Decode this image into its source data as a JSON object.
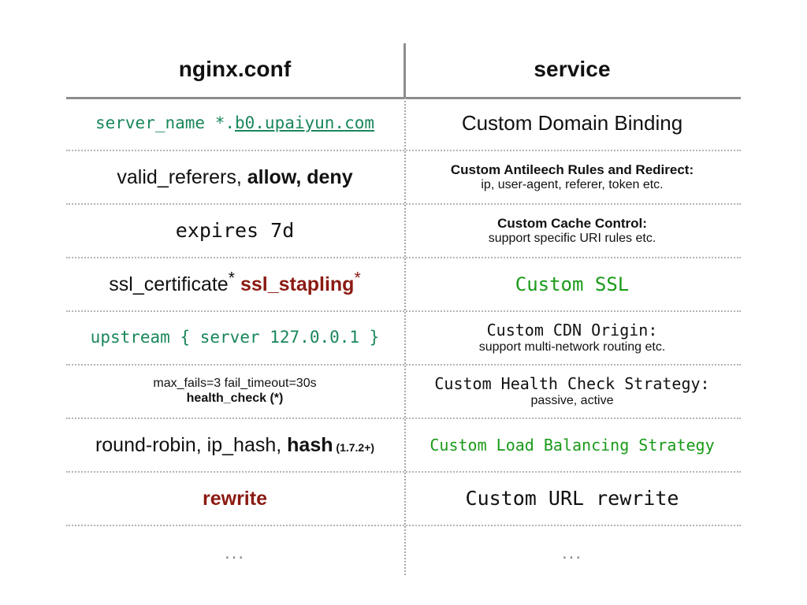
{
  "table": {
    "headers": {
      "left": "nginx.conf",
      "right": "service"
    },
    "rows": [
      {
        "left": {
          "main_prefix": "server_name *.",
          "main_link": "b0.upaiyun.com",
          "style": "mono-green-link"
        },
        "right": {
          "main": "Custom Domain Binding",
          "sub": "",
          "style": "sans-plain-large"
        }
      },
      {
        "left": {
          "main_plain": "valid_referers, ",
          "main_bold": "allow, deny",
          "style": "sans-mixed"
        },
        "right": {
          "main": "Custom Antileech Rules and Redirect:",
          "sub": "ip, user-agent, referer, token etc.",
          "style": "sans-bold-title-sub"
        }
      },
      {
        "left": {
          "main": "expires 7d",
          "style": "mono-black"
        },
        "right": {
          "main": "Custom Cache Control:",
          "sub": "support specific URI rules etc.",
          "style": "sans-bold-title-sub"
        }
      },
      {
        "left": {
          "main_plain": "ssl_certificate",
          "main_star1": "*",
          "main_bold": "ssl_stapling",
          "main_star2": "*",
          "style": "sans-mixed-red"
        },
        "right": {
          "main": "Custom SSL",
          "sub": "",
          "style": "mono-green-bright"
        }
      },
      {
        "left": {
          "main": "upstream { server 127.0.0.1 }",
          "style": "mono-green-teal"
        },
        "right": {
          "main": "Custom CDN Origin:",
          "sub": "support multi-network routing etc.",
          "style": "mono-title-sans-sub"
        }
      },
      {
        "left": {
          "main": "max_fails=3 fail_timeout=30s",
          "sub": "health_check (*)",
          "style": "sans-small-two-line"
        },
        "right": {
          "main": "Custom Health Check Strategy:",
          "sub": "passive, active",
          "style": "mono-title-sans-sub"
        }
      },
      {
        "left": {
          "main_plain": "round-robin, ip_hash, ",
          "main_bold": "hash",
          "main_note": " (1.7.2+)",
          "style": "sans-mixed-note"
        },
        "right": {
          "main": "Custom Load Balancing Strategy",
          "sub": "",
          "style": "mono-green-bright"
        }
      },
      {
        "left": {
          "main": "rewrite",
          "style": "sans-bold-darkred"
        },
        "right": {
          "main": "Custom URL rewrite",
          "sub": "",
          "style": "mono-black-large"
        }
      },
      {
        "left": {
          "main": "...",
          "style": "ellipsis"
        },
        "right": {
          "main": "...",
          "style": "ellipsis"
        }
      }
    ]
  },
  "colors": {
    "green_teal": "#19875a",
    "green_bright": "#1a9a1a",
    "dark_red": "#8b1a12",
    "rule_gray": "#8d8d8d",
    "dotted_gray": "#b4b4b4",
    "text_black": "#111111"
  }
}
